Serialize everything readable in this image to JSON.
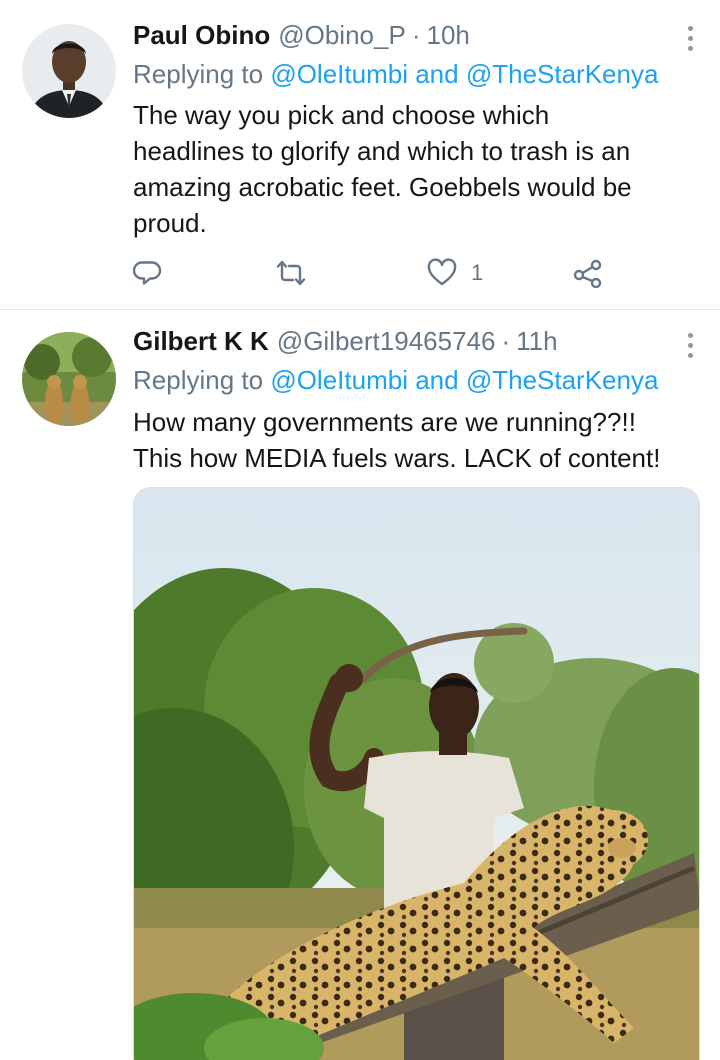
{
  "tweets": [
    {
      "name": "Paul Obino",
      "handle": "@Obino_P",
      "dot": "·",
      "time": "10h",
      "reply_prefix": "Replying to",
      "reply_user1": "@OleItumbi",
      "reply_and": "and",
      "reply_user2": "@TheStarKenya",
      "lines": [
        "The way you pick and choose which",
        "headlines to glorify and which to trash is an",
        "amazing acrobatic feet. Goebbels would be",
        "proud."
      ],
      "actions": {
        "reply_icon": "reply-icon",
        "retweet_icon": "retweet-icon",
        "like_icon": "heart-icon",
        "like_count": "1",
        "share_icon": "share-icon"
      }
    },
    {
      "name": "Gilbert K K",
      "handle": "@Gilbert19465746",
      "dot": "·",
      "time": "11h",
      "reply_prefix": "Replying to",
      "reply_user1": "@OleItumbi",
      "reply_and": "and",
      "reply_user2": "@TheStarKenya",
      "lines": [
        "How many governments are we running??!!",
        "This how MEDIA fuels wars. LACK of content!"
      ],
      "media_icon": "photo-man-with-stick-and-leopard-on-branch"
    }
  ],
  "colors": {
    "link": "#1da1f2",
    "muted": "#657786",
    "text": "#14171a"
  }
}
